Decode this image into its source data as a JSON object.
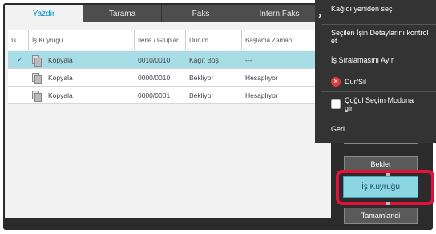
{
  "tabs": [
    {
      "label": "Yazdir",
      "active": true
    },
    {
      "label": "Tarama",
      "active": false
    },
    {
      "label": "Faks",
      "active": false
    },
    {
      "label": "Intern.Faks",
      "active": false
    }
  ],
  "table": {
    "headers": {
      "is": "Is",
      "queue": "İş Kuyruğu",
      "progress": "Ilerle / Gruplar",
      "status": "Durum",
      "start": "Başlama Zamanı"
    },
    "rows": [
      {
        "selected": true,
        "queue": "Kopyala",
        "progress": "0010/0010",
        "status": "Kağıt Boş",
        "start": "---"
      },
      {
        "selected": false,
        "queue": "Kopyala",
        "progress": "0000/0010",
        "status": "Bekliyor",
        "start": "Hesaplıyor"
      },
      {
        "selected": false,
        "queue": "Kopyala",
        "progress": "0000/0001",
        "status": "Bekliyor",
        "start": "Hesaplıyor"
      }
    ]
  },
  "menu": {
    "items": [
      {
        "label": "Kağıdı yeniden seç",
        "icon": "none"
      },
      {
        "label": "Seçilen İşin Detaylarını kontrol et",
        "icon": "none"
      },
      {
        "label": "İş Sıralamasını Ayır",
        "icon": "none"
      },
      {
        "label": "Dur/Sil",
        "icon": "stop-icon"
      },
      {
        "label": "Çoğul Seçim Moduna gir",
        "icon": "checkbox"
      },
      {
        "label": "Geri",
        "icon": "none"
      }
    ]
  },
  "side_buttons": {
    "beklet": "Beklet",
    "kuyruk": "İş Kuyruğu",
    "tamamlandi": "Tamamlandi"
  },
  "colors": {
    "accent": "#0095c8",
    "selected_row": "#a8dde8",
    "highlight_outline": "#e1113a"
  }
}
